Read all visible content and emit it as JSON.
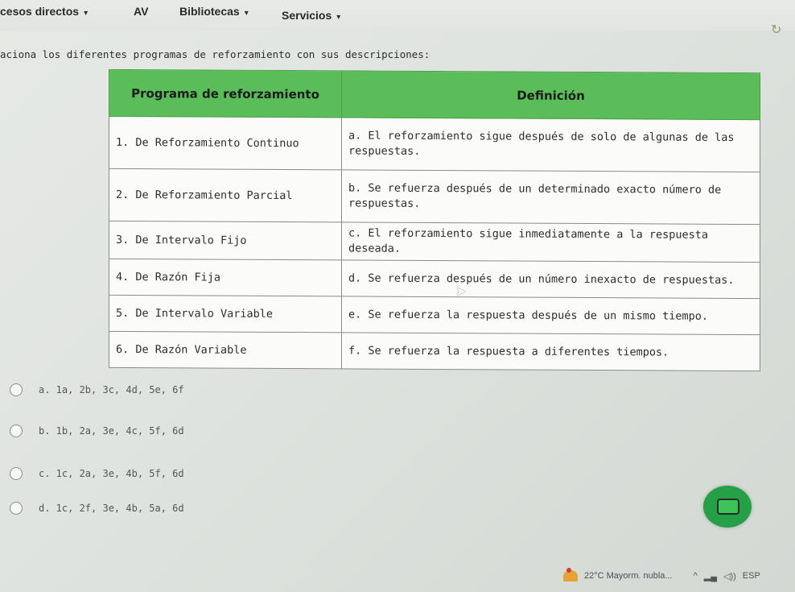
{
  "nav": {
    "items": [
      {
        "label": "cesos directos",
        "caret": "▾"
      },
      {
        "label": "AV",
        "caret": ""
      },
      {
        "label": "Bibliotecas",
        "caret": "▾"
      },
      {
        "label": "Servicios",
        "caret": "▾"
      }
    ]
  },
  "question": "aciona los diferentes programas de reforzamiento con sus descripciones:",
  "table": {
    "headers": [
      "Programa de reforzamiento",
      "Definición"
    ],
    "rows": [
      [
        "1. De Reforzamiento Continuo",
        "a. El reforzamiento sigue después de solo de algunas de las respuestas."
      ],
      [
        "2. De Reforzamiento Parcial",
        "b. Se refuerza después de un determinado exacto número de respuestas."
      ],
      [
        "3. De Intervalo Fijo",
        "c. El reforzamiento sigue inmediatamente a la respuesta deseada."
      ],
      [
        "4. De Razón Fija",
        "d. Se refuerza después de un número inexacto de respuestas."
      ],
      [
        "5. De Intervalo Variable",
        "e. Se refuerza la respuesta después de un mismo tiempo."
      ],
      [
        "6. De Razón Variable",
        "f. Se refuerza la respuesta a diferentes tiempos."
      ]
    ]
  },
  "options": [
    "a.  1a, 2b, 3c, 4d, 5e, 6f",
    "b.  1b, 2a, 3e, 4c, 5f, 6d",
    "c.  1c, 2a, 3e, 4b, 5f, 6d",
    "d.  1c, 2f, 3e, 4b, 5a, 6d"
  ],
  "taskbar": {
    "weather": "22°C  Mayorm. nubla...",
    "lang": "ESP"
  },
  "colors": {
    "header_green": "#5bbd5a",
    "chat_green": "#25a046"
  },
  "icons": [
    "chat-icon",
    "weather-icon",
    "refresh-icon"
  ]
}
